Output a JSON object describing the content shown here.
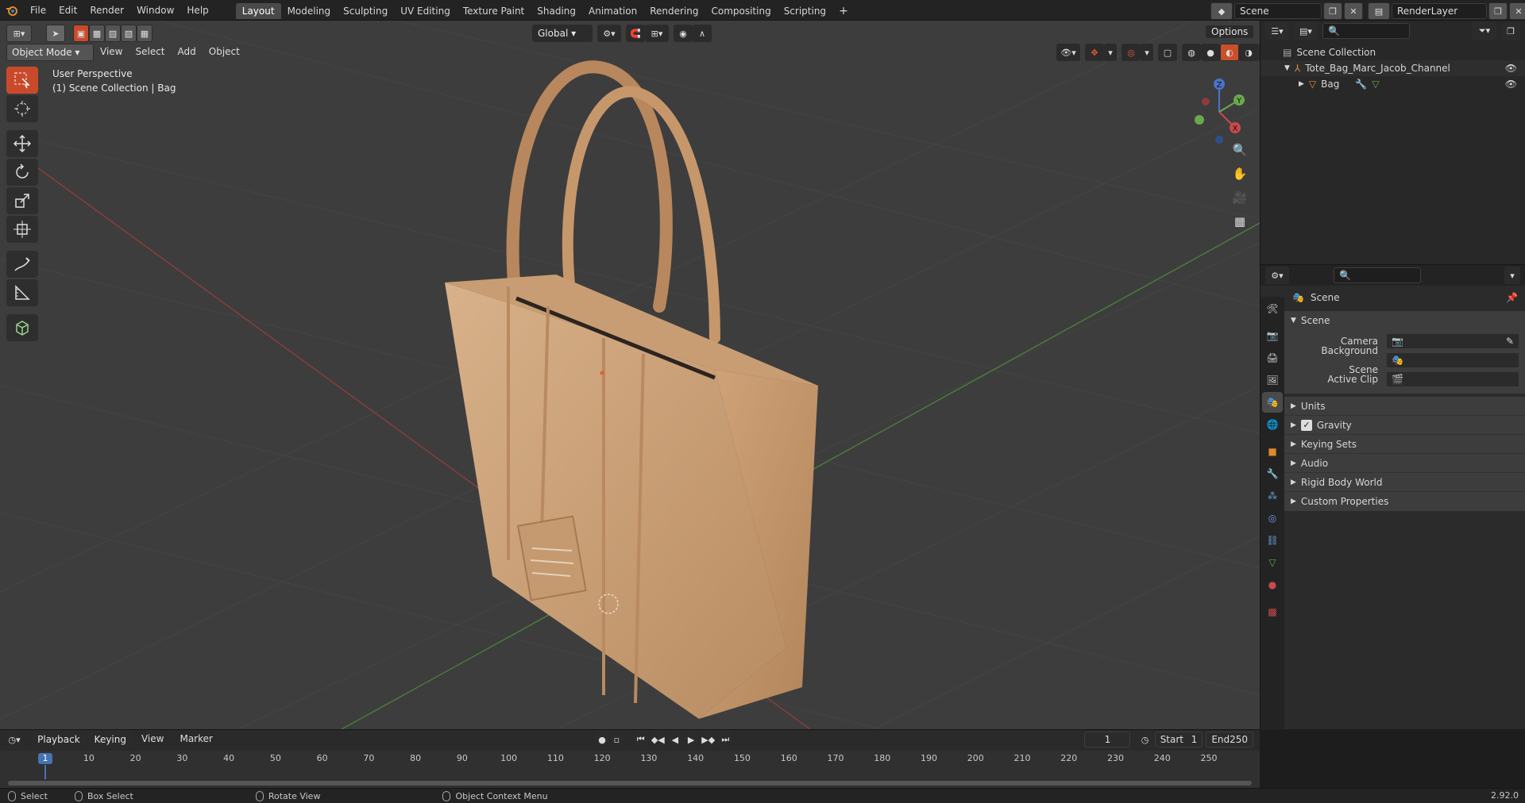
{
  "app": {
    "menu": [
      "File",
      "Edit",
      "Render",
      "Window",
      "Help"
    ],
    "workspaces": [
      "Layout",
      "Modeling",
      "Sculpting",
      "UV Editing",
      "Texture Paint",
      "Shading",
      "Animation",
      "Rendering",
      "Compositing",
      "Scripting"
    ],
    "active_workspace": "Layout",
    "add_tab": "+",
    "scene_field": "Scene",
    "renderlayer_field": "RenderLayer"
  },
  "viewport": {
    "mode": "Object Mode",
    "menu": [
      "View",
      "Select",
      "Add",
      "Object"
    ],
    "transform": "Global",
    "options": "Options",
    "info_line1": "User Perspective",
    "info_line2": "(1) Scene Collection | Bag",
    "gizmo": {
      "x": "X",
      "y": "Y",
      "z": "Z"
    }
  },
  "outliner": {
    "root": "Scene Collection",
    "collection": "Tote_Bag_Marc_Jacob_Channel",
    "object": "Bag"
  },
  "properties": {
    "header_label": "Scene",
    "panel_title": "Scene",
    "camera_label": "Camera",
    "background_label": "Background Scene",
    "clip_label": "Active Clip",
    "subpanels": [
      "Units",
      "Gravity",
      "Keying Sets",
      "Audio",
      "Rigid Body World",
      "Custom Properties"
    ],
    "gravity_checked": true
  },
  "timeline": {
    "menu": [
      "Playback",
      "Keying",
      "View",
      "Marker"
    ],
    "current_frame": "1",
    "start_label": "Start",
    "start_value": "1",
    "end_label": "End",
    "end_value": "250",
    "ticks": [
      "1",
      "10",
      "20",
      "30",
      "40",
      "50",
      "60",
      "70",
      "80",
      "90",
      "100",
      "110",
      "120",
      "130",
      "140",
      "150",
      "160",
      "170",
      "180",
      "190",
      "200",
      "210",
      "220",
      "230",
      "240",
      "250"
    ]
  },
  "statusbar": {
    "select": "Select",
    "box_select": "Box Select",
    "rotate": "Rotate View",
    "context_menu": "Object Context Menu",
    "version": "2.92.0"
  },
  "colors": {
    "accent": "#4772b3",
    "bag": "#c9a17a",
    "x_axis": "#c94a4a",
    "y_axis": "#6aa84f",
    "z_axis": "#4a74c9"
  }
}
